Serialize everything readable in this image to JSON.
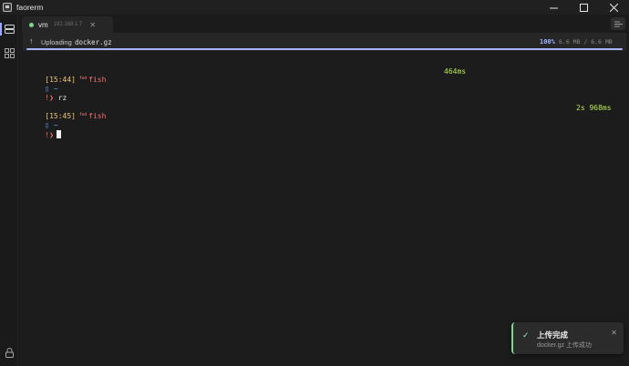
{
  "window": {
    "title": "faorerm"
  },
  "tab": {
    "name": "vm",
    "host": "192.168.1.7",
    "close": "✕",
    "status_color": "#7bd88f"
  },
  "upload": {
    "label": "Uploading",
    "file": "docker.gz",
    "percent": "100%",
    "size": "6.6 MB / 6.6 MB",
    "progress": 1.0
  },
  "terminal": {
    "block1": {
      "time": "[15:44]",
      "tag": "fed",
      "shell": "fish",
      "duration": "464ms",
      "path_mark": "▯",
      "path": "~",
      "prompt": "!❯",
      "command": "rz"
    },
    "block2": {
      "time": "[15:45]",
      "tag": "fed",
      "shell": "fish",
      "duration": "2s 968ms",
      "path_mark": "▯",
      "path": "~",
      "prompt": "!❯"
    }
  },
  "toast": {
    "title": "上传完成",
    "message": "docker.gz 上传成功",
    "check": "✓",
    "close": "✕"
  },
  "colors": {
    "accent": "#9fb4ff",
    "success": "#7bd88f",
    "prompt_time": "#f0c674",
    "prompt_error": "#ff6b6b",
    "path": "#5da9ff",
    "duration": "#b5e853"
  }
}
